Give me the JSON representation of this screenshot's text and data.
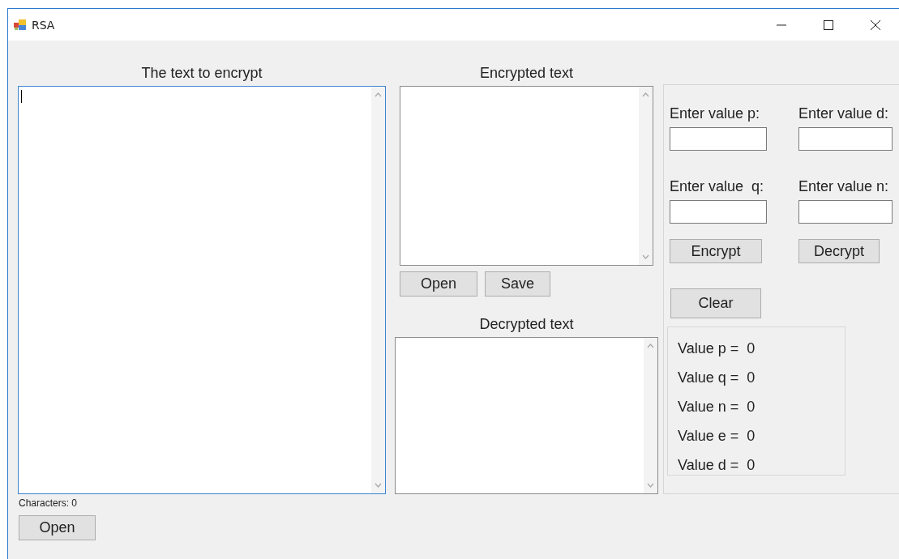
{
  "window": {
    "title": "RSA"
  },
  "plain_panel": {
    "label": "The text to encrypt",
    "focused": true,
    "characters": "Characters: 0",
    "open_button": "Open"
  },
  "encrypted_panel": {
    "label": "Encrypted text",
    "focused": false,
    "buttons": [
      "Open",
      "Save"
    ]
  },
  "decrypted_panel": {
    "label": "Decrypted text",
    "focused": false
  },
  "key_inputs": [
    {
      "label": "Enter value p:"
    },
    {
      "label": "Enter value d:"
    },
    {
      "label": "Enter value  q:"
    },
    {
      "label": "Enter value n:"
    }
  ],
  "actions": [
    "Encrypt",
    "Decrypt"
  ],
  "clear_button": "Clear",
  "values": [
    "Value p =  0",
    "Value q =  0",
    "Value n =  0",
    "Value e =  0",
    "Value d =  0"
  ]
}
